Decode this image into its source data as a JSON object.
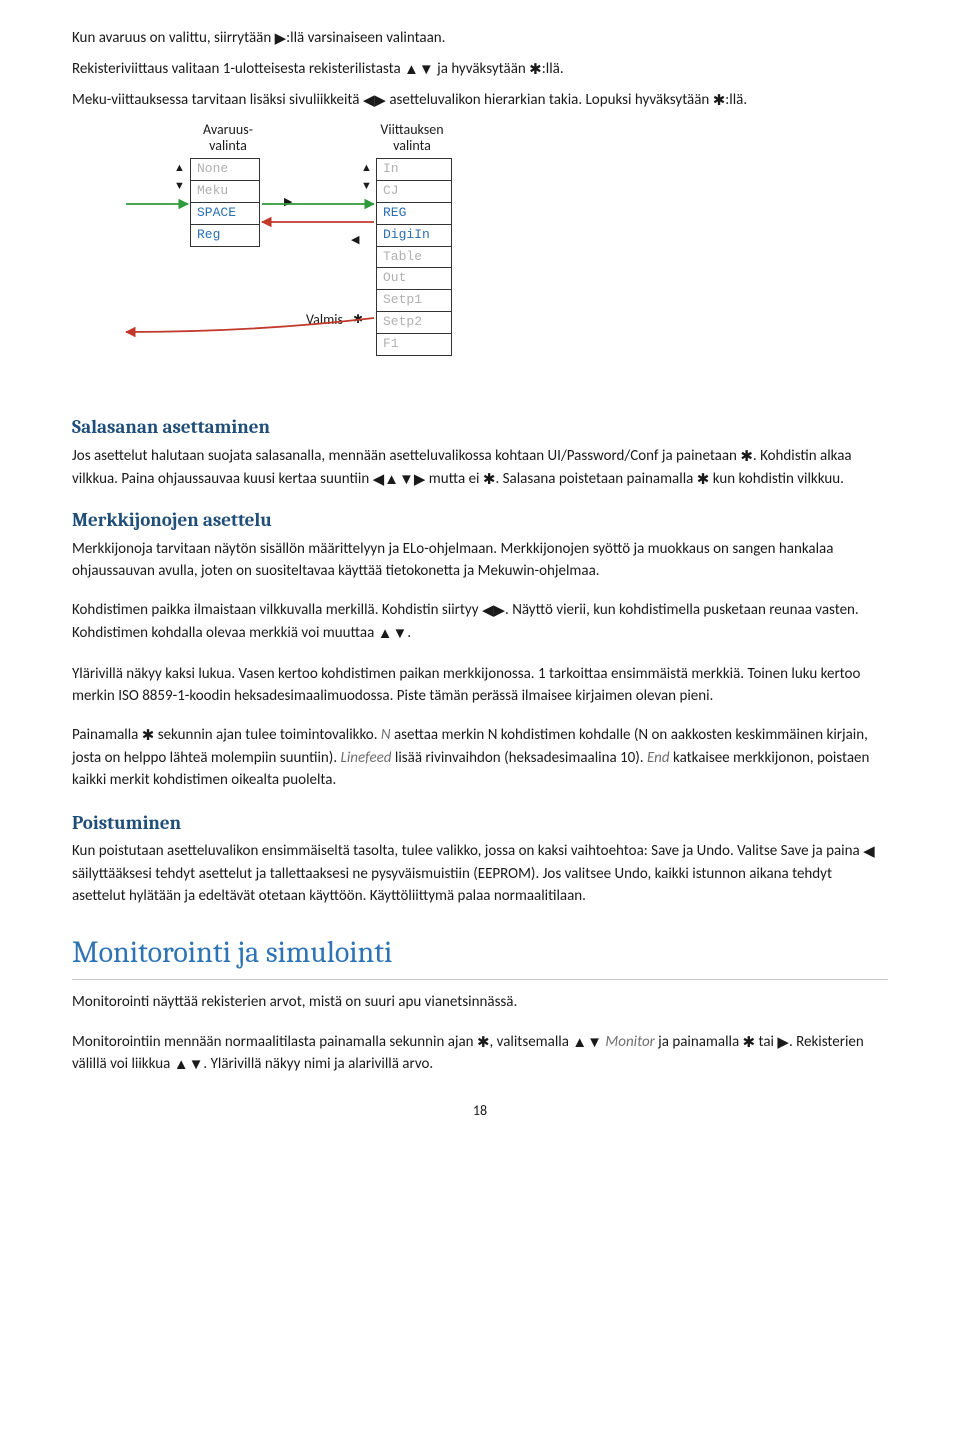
{
  "intro": {
    "p1_a": "Kun avaruus on valittu, siirrytään ",
    "p1_b": ":llä varsinaiseen valintaan.",
    "p2_a": "Rekisteriviittaus valitaan 1-ulotteisesta rekisterilistasta ",
    "p2_b": " ja hyväksytään ",
    "p2_c": ":llä.",
    "p3_a": "Meku-viittauksessa tarvitaan lisäksi sivuliikkeitä ",
    "p3_b": " asetteluvalikon hierarkian takia. Lopuksi hyväksytään ",
    "p3_c": ":llä."
  },
  "diagram": {
    "col1_title": "Avaruus-\nvalinta",
    "col2_title": "Viittauksen\nvalinta",
    "list1": [
      "None",
      "Meku",
      "SPACE",
      "Reg"
    ],
    "list2": [
      "In",
      "CJ",
      "REG",
      "DigiIn",
      "Table",
      "Out",
      "Setp1",
      "Setp2",
      "F1"
    ],
    "valmis": "Valmis"
  },
  "pw": {
    "heading": "Salasanan asettaminen",
    "p_a": "Jos asettelut halutaan suojata salasanalla, mennään asetteluvalikossa kohtaan UI/Password/Conf ja painetaan ",
    "p_b": ". Kohdistin alkaa vilkkua. Paina ohjaussauvaa kuusi kertaa suuntiin ",
    "p_c": " mutta ei ",
    "p_d": ". Salasana poistetaan painamalla ",
    "p_e": " kun kohdistin vilkkuu."
  },
  "strings": {
    "heading": "Merkkijonojen asettelu",
    "p1": "Merkkijonoja tarvitaan näytön sisällön määrittelyyn ja ELo-ohjelmaan. Merkkijonojen syöttö ja muokkaus on sangen hankalaa ohjaussauvan avulla, joten on suositeltavaa käyttää tietokonetta ja Mekuwin-ohjelmaa.",
    "p2_a": "Kohdistimen paikka ilmaistaan vilkkuvalla merkillä. Kohdistin siirtyy ",
    "p2_b": ". Näyttö vierii, kun kohdistimella pusketaan reunaa vasten. Kohdistimen kohdalla olevaa merkkiä voi muuttaa ",
    "p2_c": ".",
    "p3": "Ylärivillä näkyy kaksi lukua. Vasen kertoo kohdistimen paikan merkkijonossa. 1 tarkoittaa ensimmäistä merkkiä. Toinen luku kertoo merkin ISO 8859-1-koodin heksadesimaalimuodossa. Piste tämän perässä ilmaisee kirjaimen olevan pieni.",
    "p4_a": "Painamalla ",
    "p4_b": " sekunnin ajan tulee toimintovalikko. ",
    "p4_n": "N",
    "p4_c": " asettaa merkin N kohdistimen kohdalle (N on aakkosten keskimmäinen kirjain, josta on helppo lähteä molempiin suuntiin). ",
    "p4_lf": "Linefeed",
    "p4_d": " lisää rivinvaihdon (heksadesimaalina 10). ",
    "p4_end": "End",
    "p4_e": " katkaisee merkkijonon, poistaen kaikki merkit kohdistimen oikealta puolelta."
  },
  "exit": {
    "heading": "Poistuminen",
    "p_a": "Kun poistutaan asetteluvalikon ensimmäiseltä tasolta, tulee valikko, jossa on kaksi vaihtoehtoa: Save ja Undo. Valitse Save ja paina ",
    "p_b": " säilyttääksesi tehdyt asettelut ja tallettaaksesi ne pysyväismuistiin (EEPROM). Jos valitsee Undo, kaikki istunnon aikana tehdyt asettelut hylätään ja edeltävät otetaan käyttöön. Käyttöliittymä palaa normaalitilaan."
  },
  "monitor": {
    "heading": "Monitorointi ja simulointi",
    "p1": "Monitorointi näyttää rekisterien arvot, mistä on suuri apu vianetsinnässä.",
    "p2_a": "Monitorointiin mennään normaalitilasta painamalla sekunnin ajan ",
    "p2_b": ", valitsemalla ",
    "p2_mon": "Monitor",
    "p2_c": " ja painamalla ",
    "p2_d": " tai ",
    "p2_e": ". Rekisterien välillä voi liikkua ",
    "p2_f": ". Ylärivillä näkyy nimi ja alarivillä arvo."
  },
  "page_number": "18"
}
